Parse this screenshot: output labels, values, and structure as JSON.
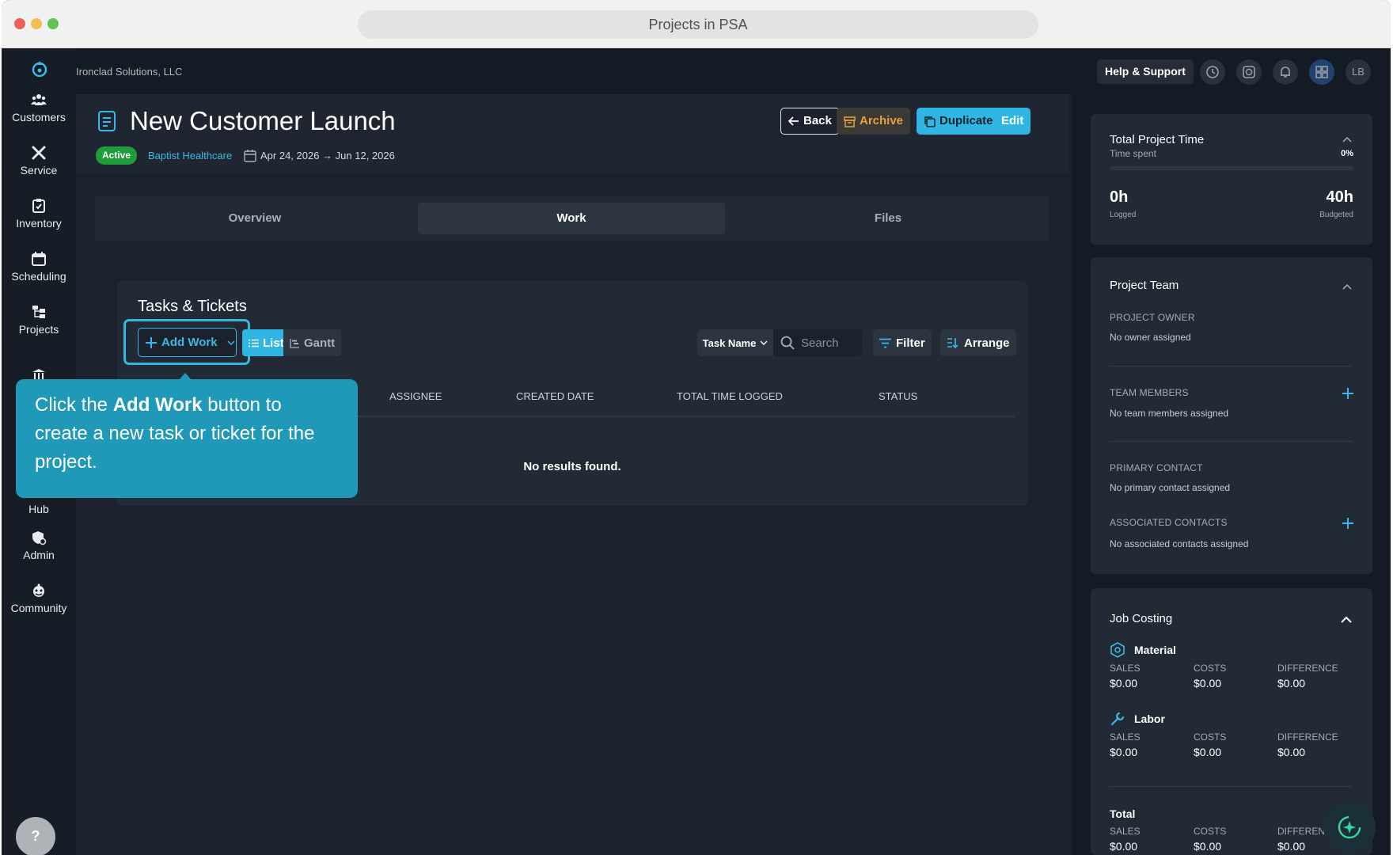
{
  "browser": {
    "title": "Projects in PSA"
  },
  "topbar": {
    "org_name": "Ironclad Solutions, LLC",
    "help_label": "Help & Support",
    "avatar_initials": "LB"
  },
  "sidebar": {
    "items": [
      {
        "label": "Customers",
        "icon": "customers-icon"
      },
      {
        "label": "Service",
        "icon": "wrench-icon"
      },
      {
        "label": "Inventory",
        "icon": "clipboard-icon"
      },
      {
        "label": "Scheduling",
        "icon": "calendar-icon"
      },
      {
        "label": "Projects",
        "icon": "projects-icon"
      },
      {
        "label": "Hub",
        "icon": "bank-icon"
      },
      {
        "label": "Admin",
        "icon": "admin-icon"
      },
      {
        "label": "Community",
        "icon": "community-icon"
      }
    ],
    "help_fab": "?"
  },
  "project": {
    "title": "New Customer Launch",
    "status": "Active",
    "customer": "Baptist Healthcare",
    "dates": "Apr 24, 2026 → Jun 12, 2026",
    "buttons": {
      "back": "Back",
      "archive": "Archive",
      "duplicate": "Duplicate",
      "edit": "Edit"
    }
  },
  "tabs": [
    "Overview",
    "Work",
    "Files"
  ],
  "tasks": {
    "title": "Tasks & Tickets",
    "add_work": "Add Work",
    "view_list": "List",
    "view_gantt": "Gantt",
    "sort_field": "Task Name",
    "search_placeholder": "Search",
    "filter": "Filter",
    "arrange": "Arrange",
    "columns": [
      "ASSIGNEE",
      "CREATED DATE",
      "TOTAL TIME LOGGED",
      "STATUS"
    ],
    "empty": "No results found."
  },
  "tooltip": {
    "pre": "Click the ",
    "bold": "Add Work",
    "post": " button to create a new task or ticket for the project."
  },
  "time_card": {
    "title": "Total Project Time",
    "subtitle": "Time spent",
    "percent": "0%",
    "logged_value": "0h",
    "logged_label": "Logged",
    "budget_value": "40h",
    "budget_label": "Budgeted",
    "progress": 0
  },
  "team_card": {
    "title": "Project Team",
    "owner_label": "PROJECT OWNER",
    "owner_value": "No owner assigned",
    "members_label": "TEAM MEMBERS",
    "members_value": "No team members assigned",
    "primary_label": "PRIMARY CONTACT",
    "primary_value": "No primary contact assigned",
    "assoc_label": "ASSOCIATED CONTACTS",
    "assoc_value": "No associated contacts assigned"
  },
  "job_costing": {
    "title": "Job Costing",
    "material": {
      "label": "Material",
      "sales_label": "SALES",
      "sales": "$0.00",
      "costs_label": "COSTS",
      "costs": "$0.00",
      "diff_label": "DIFFERENCE",
      "diff": "$0.00"
    },
    "labor": {
      "label": "Labor",
      "sales_label": "SALES",
      "sales": "$0.00",
      "costs_label": "COSTS",
      "costs": "$0.00",
      "diff_label": "DIFFERENCE",
      "diff": "$0.00"
    },
    "total": {
      "label": "Total",
      "sales_label": "SALES",
      "sales": "$0.00",
      "costs_label": "COSTS",
      "costs": "$0.00",
      "diff_label": "DIFFEREN",
      "diff": "$0.00"
    }
  },
  "colors": {
    "accent": "#3bb8e3",
    "active": "#1f9d3a",
    "archive": "#e8a03a"
  }
}
